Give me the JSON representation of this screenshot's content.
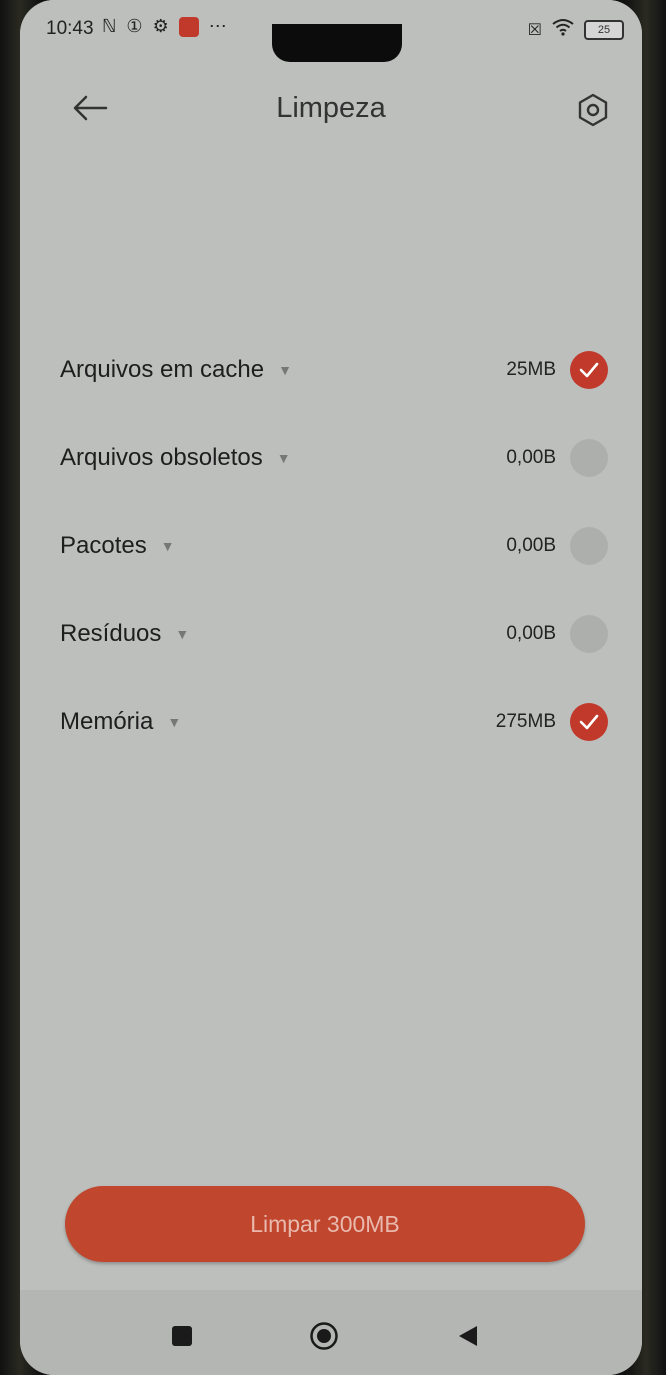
{
  "status_bar": {
    "time": "10:43",
    "battery": "25"
  },
  "toolbar": {
    "title": "Limpeza",
    "back_icon": "arrow-left-icon",
    "settings_icon": "hexagon-settings-icon"
  },
  "items": [
    {
      "label": "Arquivos em cache",
      "size": "25MB",
      "checked": true
    },
    {
      "label": "Arquivos obsoletos",
      "size": "0,00B",
      "checked": false
    },
    {
      "label": "Pacotes",
      "size": "0,00B",
      "checked": false
    },
    {
      "label": "Resíduos",
      "size": "0,00B",
      "checked": false
    },
    {
      "label": "Memória",
      "size": "275MB",
      "checked": true
    }
  ],
  "clean_button": {
    "label": "Limpar 300MB"
  },
  "colors": {
    "accent": "#c0392b",
    "button": "#c0462e"
  },
  "nav": {
    "recents_icon": "square-icon",
    "home_icon": "circle-icon",
    "back_icon": "triangle-back-icon"
  }
}
